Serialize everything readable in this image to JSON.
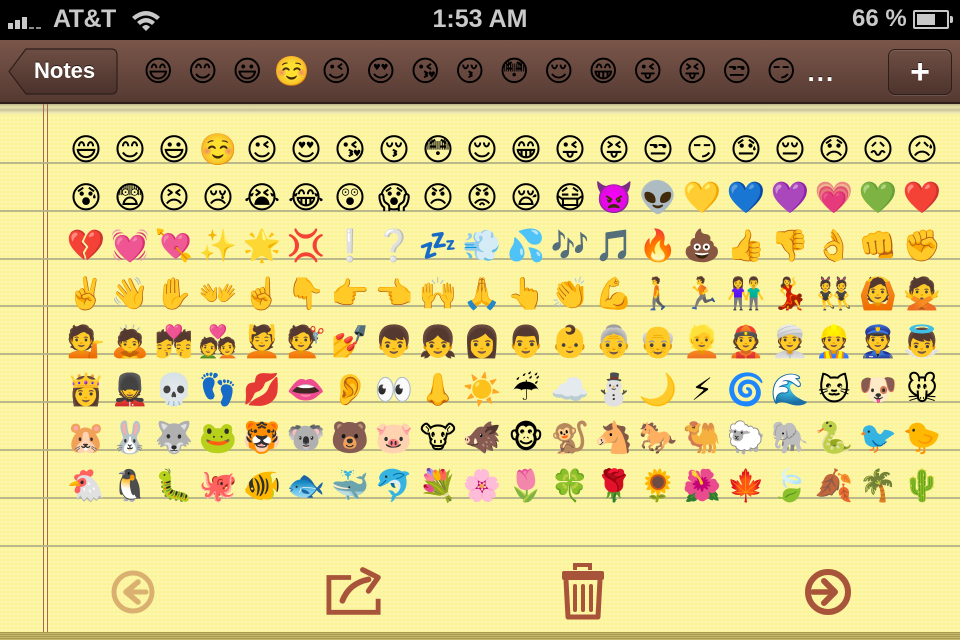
{
  "status_bar": {
    "carrier": "AT&T",
    "time": "1:53 AM",
    "battery_percent_label": "66 %",
    "battery_level": 0.66,
    "signal_bars": 3,
    "signal_bars_total": 5,
    "wifi": "wifi-icon"
  },
  "nav": {
    "back_label": "Notes",
    "title_emojis": [
      "😄",
      "😊",
      "😃",
      "☺️",
      "😉",
      "😍",
      "😘",
      "😚",
      "😳",
      "😌",
      "😁",
      "😜",
      "😝",
      "😒",
      "😏"
    ],
    "title_ellipsis": "...",
    "add_label": "+"
  },
  "note": {
    "rows": [
      [
        "😄",
        "😊",
        "😃",
        "☺️",
        "😉",
        "😍",
        "😘",
        "😚",
        "😳",
        "😌",
        "😁",
        "😜",
        "😝",
        "😒",
        "😏",
        "😓",
        "😔",
        "😞",
        "😖",
        "😥"
      ],
      [
        "😰",
        "😨",
        "😣",
        "😢",
        "😭",
        "😂",
        "😲",
        "😱",
        "😠",
        "😡",
        "😪",
        "😷",
        "👿",
        "👽",
        "💛",
        "💙",
        "💜",
        "💗",
        "💚",
        "❤️"
      ],
      [
        "💔",
        "💓",
        "💘",
        "✨",
        "🌟",
        "💢",
        "❕",
        "❔",
        "💤",
        "💨",
        "💦",
        "🎶",
        "🎵",
        "🔥",
        "💩",
        "👍",
        "👎",
        "👌",
        "👊",
        "✊"
      ],
      [
        "✌️",
        "👋",
        "✋",
        "👐",
        "☝️",
        "👇",
        "👉",
        "👈",
        "🙌",
        "🙏",
        "👆",
        "👏",
        "💪",
        "🚶",
        "🏃",
        "👫",
        "💃",
        "👯",
        "🙆",
        "🙅"
      ],
      [
        "💁",
        "🙇",
        "💏",
        "💑",
        "💆",
        "💇",
        "💅",
        "👦",
        "👧",
        "👩",
        "👨",
        "👶",
        "👵",
        "👴",
        "👱",
        "👲",
        "👳",
        "👷",
        "👮",
        "👼"
      ],
      [
        "👸",
        "💂",
        "💀",
        "👣",
        "💋",
        "👄",
        "👂",
        "👀",
        "👃",
        "☀️",
        "☔",
        "☁️",
        "⛄",
        "🌙",
        "⚡",
        "🌀",
        "🌊",
        "🐱",
        "🐶",
        "🐭"
      ],
      [
        "🐹",
        "🐰",
        "🐺",
        "🐸",
        "🐯",
        "🐨",
        "🐻",
        "🐷",
        "🐮",
        "🐗",
        "🐵",
        "🐒",
        "🐴",
        "🐎",
        "🐫",
        "🐑",
        "🐘",
        "🐍",
        "🐦",
        "🐤"
      ],
      [
        "🐔",
        "🐧",
        "🐛",
        "🐙",
        "🐠",
        "🐟",
        "🐳",
        "🐬",
        "💐",
        "🌸",
        "🌷",
        "🍀",
        "🌹",
        "🌻",
        "🌺",
        "🍁",
        "🍃",
        "🍂",
        "🌴",
        "🌵"
      ]
    ]
  },
  "toolbar": {
    "back": {
      "icon": "arrow-left-circle-icon",
      "enabled": false
    },
    "share": {
      "icon": "share-icon",
      "enabled": true
    },
    "trash": {
      "icon": "trash-icon",
      "enabled": true
    },
    "forward": {
      "icon": "arrow-right-circle-icon",
      "enabled": true
    }
  },
  "colors": {
    "paper": "#fbf49a",
    "nav_bar": "#6a4a40",
    "toolbar_icon": "#a8543a",
    "toolbar_icon_disabled": "#d9b070",
    "rule": "#b3b08a",
    "margin": "#a6684e"
  }
}
